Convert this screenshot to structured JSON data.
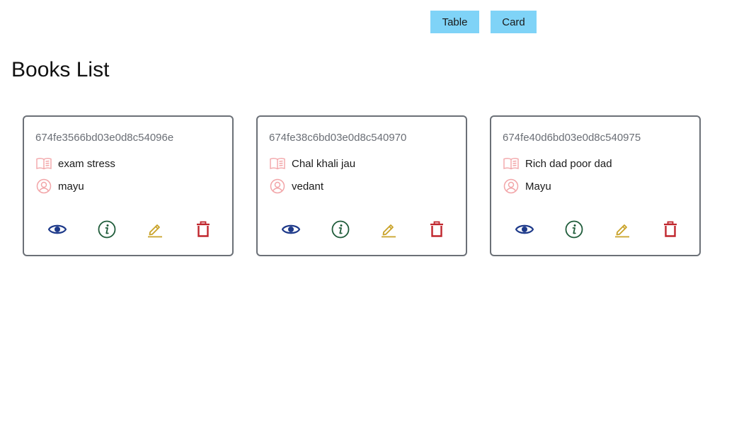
{
  "toolbar": {
    "table_label": "Table",
    "card_label": "Card"
  },
  "page": {
    "title": "Books List"
  },
  "colors": {
    "toggle_bg": "#7fd3f7",
    "view_icon": "#1e3a8a",
    "info_icon": "#1f5c3a",
    "edit_icon": "#c9a227",
    "delete_icon": "#c0262d",
    "meta_icon": "#f2a5a8"
  },
  "icons": {
    "title_icon": "book-open-icon",
    "author_icon": "user-circle-icon",
    "actions": [
      "eye-icon",
      "info-circle-icon",
      "pencil-icon",
      "trash-icon"
    ]
  },
  "books": [
    {
      "id": "674fe3566bd03e0d8c54096e",
      "title": "exam stress",
      "author": "mayu"
    },
    {
      "id": "674fe38c6bd03e0d8c540970",
      "title": "Chal khali jau",
      "author": "vedant"
    },
    {
      "id": "674fe40d6bd03e0d8c540975",
      "title": "Rich dad poor dad",
      "author": "Mayu"
    }
  ]
}
